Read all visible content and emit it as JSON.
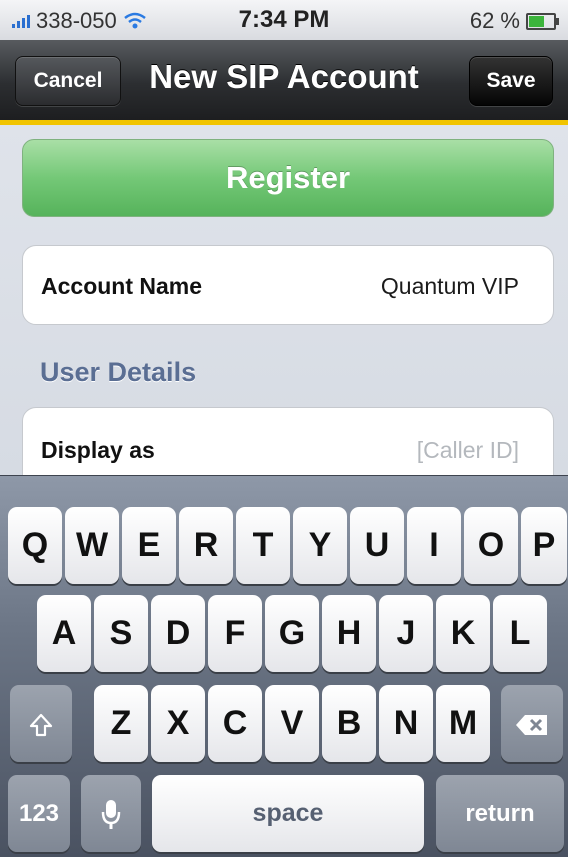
{
  "status_bar": {
    "carrier": "338-050",
    "time": "7:34 PM",
    "battery": "62 %",
    "battery_level": 0.62
  },
  "nav": {
    "title": "New SIP Account",
    "cancel_label": "Cancel",
    "save_label": "Save"
  },
  "register": {
    "label": "Register"
  },
  "account": {
    "label": "Account Name",
    "value": "Quantum VIP"
  },
  "user_details": {
    "header": "User Details",
    "display_label": "Display as",
    "display_placeholder": "[Caller ID]"
  },
  "keyboard": {
    "row1": [
      "Q",
      "W",
      "E",
      "R",
      "T",
      "Y",
      "U",
      "I",
      "O",
      "P"
    ],
    "row2": [
      "A",
      "S",
      "D",
      "F",
      "G",
      "H",
      "J",
      "K",
      "L"
    ],
    "row3": [
      "Z",
      "X",
      "C",
      "V",
      "B",
      "N",
      "M"
    ],
    "numbers_label": "123",
    "space_label": "space",
    "return_label": "return"
  },
  "icons": {
    "signal": "signal-bars-icon",
    "wifi": "wifi-icon",
    "battery": "battery-icon",
    "shift": "shift-arrow-icon",
    "backspace": "backspace-icon",
    "microphone": "microphone-icon"
  },
  "colors": {
    "accent": "#f1c400",
    "register_green": "#74c877",
    "section_header": "#5a6e93"
  }
}
